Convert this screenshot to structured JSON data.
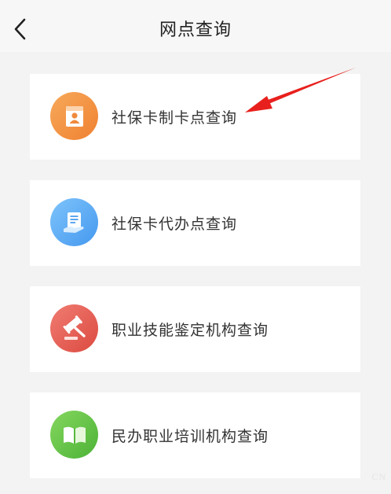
{
  "header": {
    "title": "网点查询"
  },
  "items": [
    {
      "label": "社保卡制卡点查询",
      "icon": "id-card-icon",
      "color_start": "#f7a95a",
      "color_end": "#ef8131"
    },
    {
      "label": "社保卡代办点查询",
      "icon": "document-hand-icon",
      "color_start": "#7ec4fb",
      "color_end": "#4598ef"
    },
    {
      "label": "职业技能鉴定机构查询",
      "icon": "gavel-icon",
      "color_start": "#f07c72",
      "color_end": "#dc4a40"
    },
    {
      "label": "民办职业培训机构查询",
      "icon": "open-book-icon",
      "color_start": "#85d75f",
      "color_end": "#4cb236"
    }
  ],
  "annotation_color": "#e8201d",
  "watermark": "CN"
}
